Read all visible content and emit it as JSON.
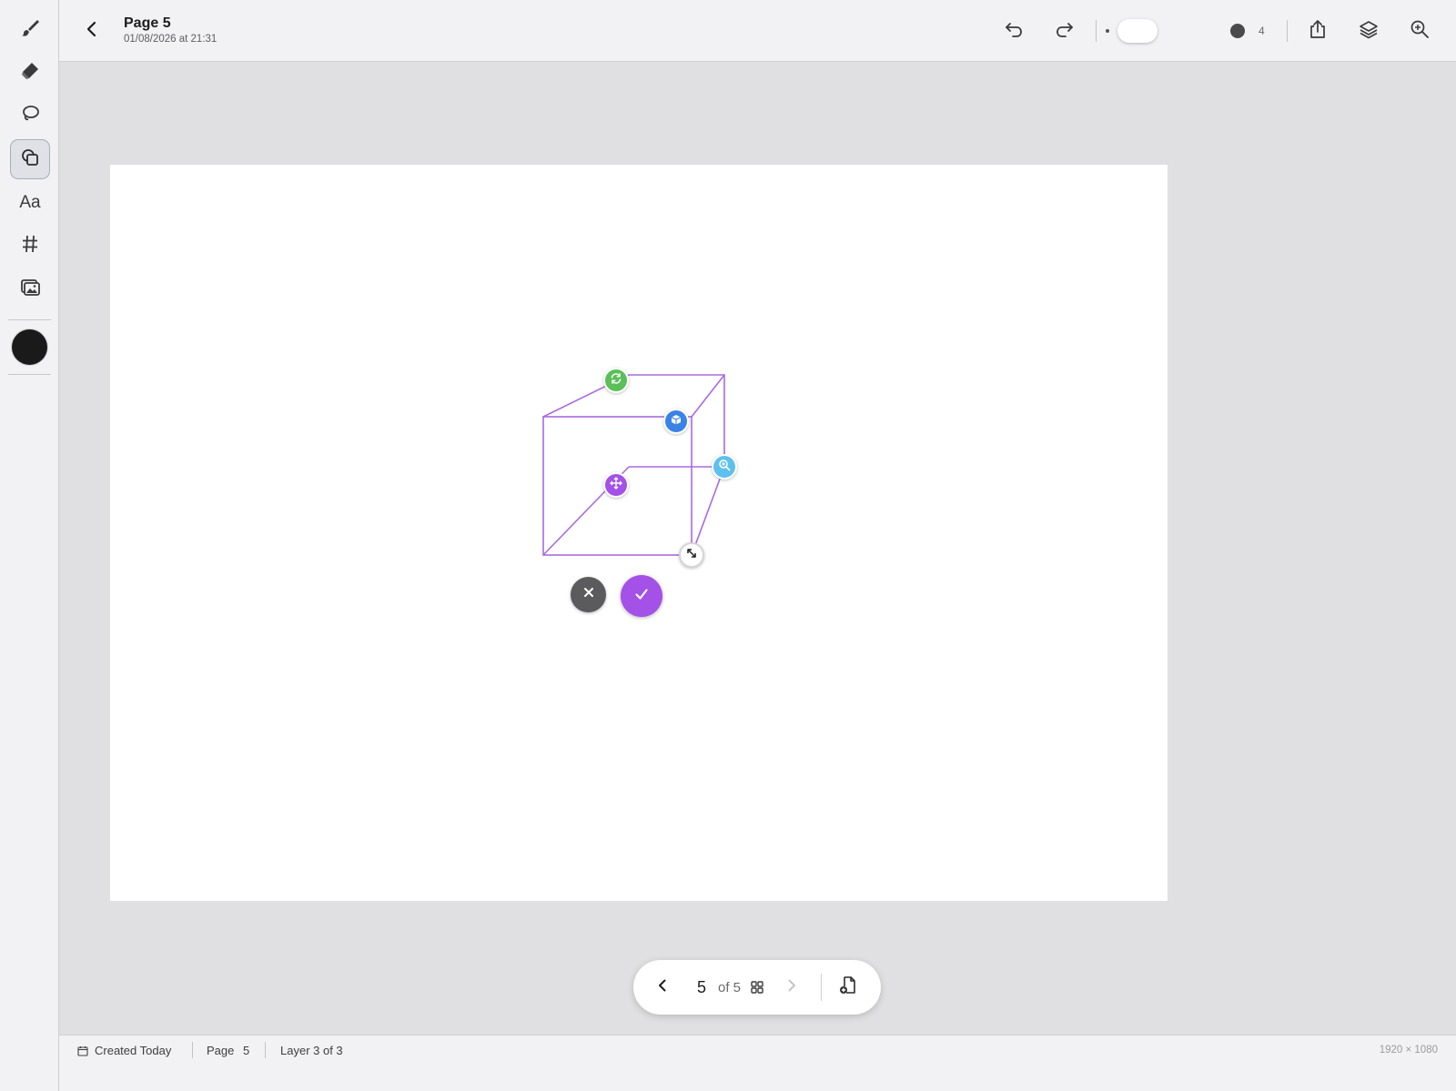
{
  "header": {
    "title": "Page 5",
    "date": "01/08/2026 at 21:31",
    "brush_size_value": "4"
  },
  "tools": [
    {
      "name": "brush",
      "icon": "brush-icon"
    },
    {
      "name": "eraser",
      "icon": "eraser-icon"
    },
    {
      "name": "lasso",
      "icon": "lasso-icon"
    },
    {
      "name": "shapes",
      "icon": "shapes-icon",
      "active": true
    },
    {
      "name": "text",
      "label": "Aa"
    },
    {
      "name": "grid",
      "icon": "hash-icon"
    },
    {
      "name": "image",
      "icon": "image-icon"
    }
  ],
  "colors": {
    "current_color": "#1a1a1a",
    "accent": "#a351e6",
    "shape_stroke": "#a96ae0",
    "rotate_handle": "#5bbf5a",
    "cube_handle": "#3b82e6",
    "zoom_handle": "#5fc0ee",
    "move_handle": "#a351e6"
  },
  "page_nav": {
    "current": "5",
    "of_label": "of 5"
  },
  "status": {
    "created": "Created Today",
    "page_label": "Page",
    "page_value": "5",
    "layer": "Layer 3 of 3",
    "dimensions": "1920 × 1080"
  }
}
